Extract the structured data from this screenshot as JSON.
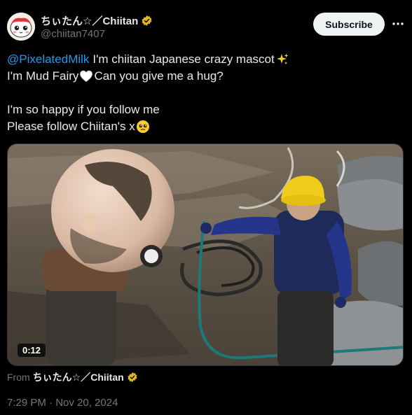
{
  "author": {
    "display_name": "ちぃたん☆／Chiitan",
    "handle": "@chiitan7407",
    "avatar": "mascot-avatar"
  },
  "subscribe_label": "Subscribe",
  "more_icon": "more-dots-icon",
  "tweet": {
    "mention": "@PixelatedMilk",
    "line1_rest": "I'm chiitan Japanese crazy mascot",
    "line1_emoji": "sparkles",
    "line2_a": "I'm Mud Fairy",
    "line2_emoji": "white-heart",
    "line2_b": "Can you give me a hug?",
    "line4": "I'm so happy if you follow me",
    "line5": "Please follow Chiitan's x",
    "line5_emoji": "pleading-face"
  },
  "video": {
    "duration": "0:12"
  },
  "source": {
    "from_label": "From",
    "name": "ちぃたん☆／Chiitan"
  },
  "timestamp": "7:29 PM · Nov 20, 2024",
  "colors": {
    "background": "#000000",
    "text": "#e7e9ea",
    "secondary": "#71767b",
    "link": "#1d9bf0",
    "verified": "#e2b719"
  }
}
